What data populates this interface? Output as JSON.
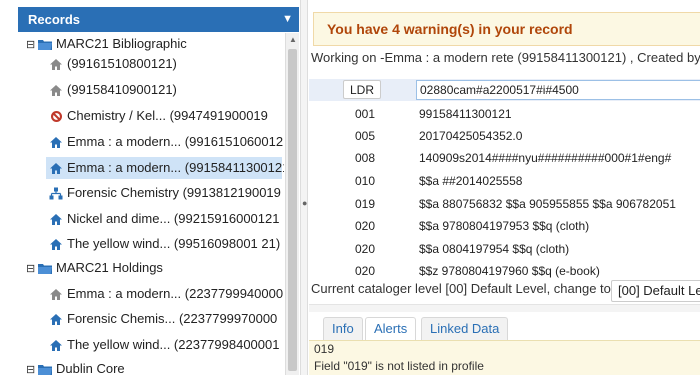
{
  "left_panel": {
    "title": "Records",
    "collapse_icon": "chevron-down-icon",
    "tree": [
      {
        "label": "MARC21 Bibliographic",
        "type": "folder",
        "toggle": "⊟"
      },
      {
        "label": "(99161510800121)",
        "type": "home"
      },
      {
        "label": "(99158410900121)",
        "type": "home"
      },
      {
        "label": "Chemistry / Kel... (9947491900019",
        "type": "blocked"
      },
      {
        "label": "Emma : a modern... (99161510600121",
        "type": "home-blue"
      },
      {
        "label": "Emma : a modern... (99158411300121",
        "type": "home-blue",
        "selected": true
      },
      {
        "label": "Forensic Chemistry (9913812190019",
        "type": "tree-blue"
      },
      {
        "label": "Nickel and dime... (99215916000121",
        "type": "home-blue"
      },
      {
        "label": "The yellow wind... (99516098001 21)",
        "type": "home-blue"
      },
      {
        "label": "MARC21 Holdings",
        "type": "folder",
        "toggle": "⊟"
      },
      {
        "label": "Emma : a modern... (22377999400001",
        "type": "home"
      },
      {
        "label": "Forensic Chemis... (2237799970000",
        "type": "home-blue"
      },
      {
        "label": "The yellow wind... (22377998400001",
        "type": "home-blue"
      },
      {
        "label": "Dublin Core",
        "type": "folder",
        "toggle": "⊟"
      }
    ]
  },
  "editor": {
    "warning": "You have 4 warning(s) in your record",
    "working_on": "Working on -Emma : a modern rete (99158411300121) , Created by",
    "rows": [
      {
        "tag": "LDR",
        "value": "02880cam#a2200517#i#4500"
      },
      {
        "tag": "001",
        "value": "99158411300121"
      },
      {
        "tag": "005",
        "value": "20170425054352.0"
      },
      {
        "tag": "008",
        "value": "140909s2014####nyu##########000#1#eng#"
      },
      {
        "tag": "010",
        "value": "$$a ##2014025558"
      },
      {
        "tag": "019",
        "value": "$$a 880756832 $$a 905955855 $$a 906782051"
      },
      {
        "tag": "020",
        "value": "$$a 9780804197953 $$q (cloth)"
      },
      {
        "tag": "020",
        "value": "$$a 0804197954 $$q (cloth)"
      },
      {
        "tag": "020",
        "value": "$$z 9780804197960 $$q (e-book)"
      }
    ],
    "cataloger_level": "Current cataloger level [00] Default Level, change to",
    "level_select": "[00] Default Le"
  },
  "tabs": [
    "Info",
    "Alerts",
    "Linked Data"
  ],
  "alerts": {
    "line1": "019",
    "line2": "Field \"019\" is not listed in profile"
  }
}
